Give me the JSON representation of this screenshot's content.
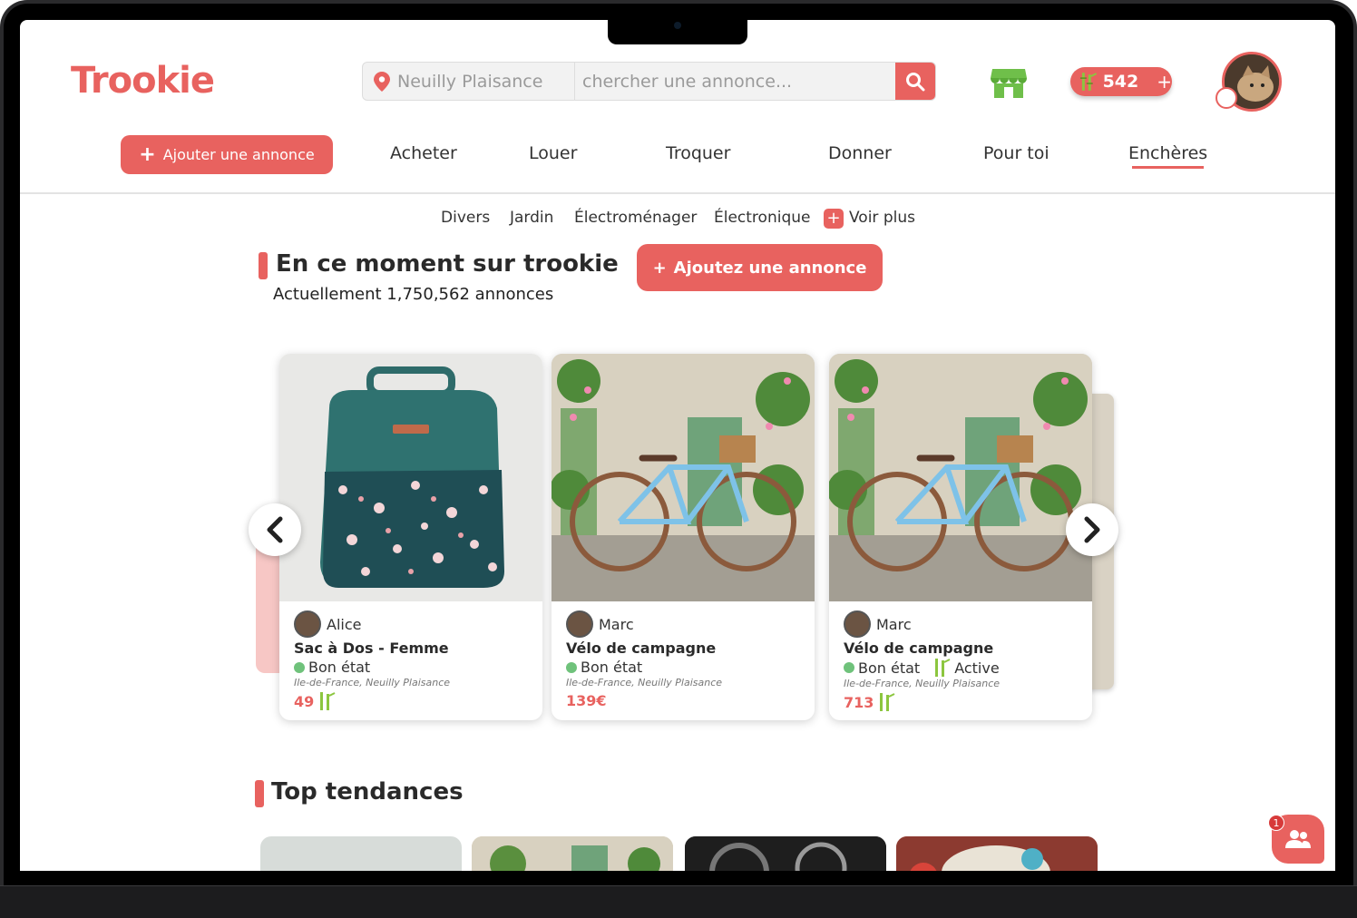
{
  "app": {
    "logo": "Trookie"
  },
  "header": {
    "location": "Neuilly Plaisance",
    "search_placeholder": "chercher une annonce...",
    "credits": "542",
    "credits_plus": "+"
  },
  "nav": {
    "add_label": "Ajouter une annonce",
    "items": [
      "Acheter",
      "Louer",
      "Troquer",
      "Donner",
      "Pour toi",
      "Enchères"
    ],
    "active": "Enchères"
  },
  "categories": {
    "items": [
      "Divers",
      "Jardin",
      "Électroménager",
      "Électronique"
    ],
    "more": "Voir plus"
  },
  "section_now": {
    "title": "En ce moment sur trookie",
    "subtitle": "Actuellement 1,750,562 annonces",
    "add_button": "Ajoutez une annonce"
  },
  "cards": [
    {
      "seller": "Alice",
      "title": "Sac à Dos - Femme",
      "state": "Bon état",
      "location": "Ile-de-France, Neuilly Plaisance",
      "price": "49",
      "badge": ""
    },
    {
      "seller": "Marc",
      "title": "Vélo de campagne",
      "state": "Bon état",
      "location": "Ile-de-France, Neuilly Plaisance",
      "price": "139€",
      "badge": ""
    },
    {
      "seller": "Marc",
      "title": "Vélo de campagne",
      "state": "Bon état",
      "location": "Ile-de-France, Neuilly Plaisance",
      "price": "713",
      "badge": "Active"
    }
  ],
  "section_trends": {
    "title": "Top tendances"
  },
  "chat": {
    "badge_count": "1"
  },
  "colors": {
    "accent": "#e8625f",
    "bamboo": "#8cc63f"
  }
}
